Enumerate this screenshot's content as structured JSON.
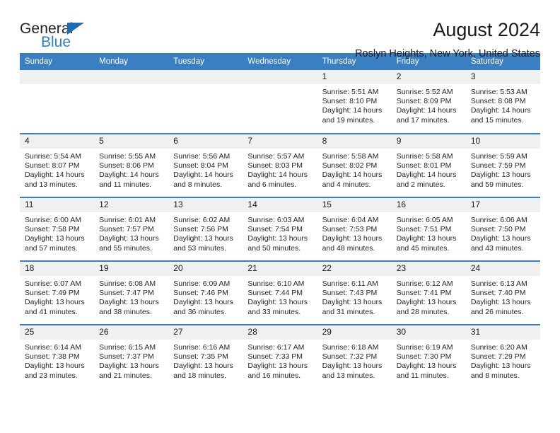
{
  "brand": {
    "name_top": "General",
    "name_bottom": "Blue",
    "triangle_color": "#1b6cb5",
    "blue_text_color": "#2b83c9"
  },
  "header": {
    "title": "August 2024",
    "subtitle": "Roslyn Heights, New York, United States"
  },
  "theme": {
    "header_bg": "#3a7fc1",
    "daynum_bg": "#f0f0f0",
    "row_divider": "#3a7fc1",
    "text": "#1a1a1a"
  },
  "weekday_headers": [
    "Sunday",
    "Monday",
    "Tuesday",
    "Wednesday",
    "Thursday",
    "Friday",
    "Saturday"
  ],
  "labels": {
    "sunrise_prefix": "Sunrise:",
    "sunset_prefix": "Sunset:",
    "daylight_prefix": "Daylight:"
  },
  "weeks": [
    [
      {
        "day": "",
        "empty": true
      },
      {
        "day": "",
        "empty": true
      },
      {
        "day": "",
        "empty": true
      },
      {
        "day": "",
        "empty": true
      },
      {
        "day": "1",
        "sunrise": "Sunrise: 5:51 AM",
        "sunset": "Sunset: 8:10 PM",
        "daylight_line1": "Daylight: 14 hours",
        "daylight_line2": "and 19 minutes."
      },
      {
        "day": "2",
        "sunrise": "Sunrise: 5:52 AM",
        "sunset": "Sunset: 8:09 PM",
        "daylight_line1": "Daylight: 14 hours",
        "daylight_line2": "and 17 minutes."
      },
      {
        "day": "3",
        "sunrise": "Sunrise: 5:53 AM",
        "sunset": "Sunset: 8:08 PM",
        "daylight_line1": "Daylight: 14 hours",
        "daylight_line2": "and 15 minutes."
      }
    ],
    [
      {
        "day": "4",
        "sunrise": "Sunrise: 5:54 AM",
        "sunset": "Sunset: 8:07 PM",
        "daylight_line1": "Daylight: 14 hours",
        "daylight_line2": "and 13 minutes."
      },
      {
        "day": "5",
        "sunrise": "Sunrise: 5:55 AM",
        "sunset": "Sunset: 8:06 PM",
        "daylight_line1": "Daylight: 14 hours",
        "daylight_line2": "and 11 minutes."
      },
      {
        "day": "6",
        "sunrise": "Sunrise: 5:56 AM",
        "sunset": "Sunset: 8:04 PM",
        "daylight_line1": "Daylight: 14 hours",
        "daylight_line2": "and 8 minutes."
      },
      {
        "day": "7",
        "sunrise": "Sunrise: 5:57 AM",
        "sunset": "Sunset: 8:03 PM",
        "daylight_line1": "Daylight: 14 hours",
        "daylight_line2": "and 6 minutes."
      },
      {
        "day": "8",
        "sunrise": "Sunrise: 5:58 AM",
        "sunset": "Sunset: 8:02 PM",
        "daylight_line1": "Daylight: 14 hours",
        "daylight_line2": "and 4 minutes."
      },
      {
        "day": "9",
        "sunrise": "Sunrise: 5:58 AM",
        "sunset": "Sunset: 8:01 PM",
        "daylight_line1": "Daylight: 14 hours",
        "daylight_line2": "and 2 minutes."
      },
      {
        "day": "10",
        "sunrise": "Sunrise: 5:59 AM",
        "sunset": "Sunset: 7:59 PM",
        "daylight_line1": "Daylight: 13 hours",
        "daylight_line2": "and 59 minutes."
      }
    ],
    [
      {
        "day": "11",
        "sunrise": "Sunrise: 6:00 AM",
        "sunset": "Sunset: 7:58 PM",
        "daylight_line1": "Daylight: 13 hours",
        "daylight_line2": "and 57 minutes."
      },
      {
        "day": "12",
        "sunrise": "Sunrise: 6:01 AM",
        "sunset": "Sunset: 7:57 PM",
        "daylight_line1": "Daylight: 13 hours",
        "daylight_line2": "and 55 minutes."
      },
      {
        "day": "13",
        "sunrise": "Sunrise: 6:02 AM",
        "sunset": "Sunset: 7:56 PM",
        "daylight_line1": "Daylight: 13 hours",
        "daylight_line2": "and 53 minutes."
      },
      {
        "day": "14",
        "sunrise": "Sunrise: 6:03 AM",
        "sunset": "Sunset: 7:54 PM",
        "daylight_line1": "Daylight: 13 hours",
        "daylight_line2": "and 50 minutes."
      },
      {
        "day": "15",
        "sunrise": "Sunrise: 6:04 AM",
        "sunset": "Sunset: 7:53 PM",
        "daylight_line1": "Daylight: 13 hours",
        "daylight_line2": "and 48 minutes."
      },
      {
        "day": "16",
        "sunrise": "Sunrise: 6:05 AM",
        "sunset": "Sunset: 7:51 PM",
        "daylight_line1": "Daylight: 13 hours",
        "daylight_line2": "and 45 minutes."
      },
      {
        "day": "17",
        "sunrise": "Sunrise: 6:06 AM",
        "sunset": "Sunset: 7:50 PM",
        "daylight_line1": "Daylight: 13 hours",
        "daylight_line2": "and 43 minutes."
      }
    ],
    [
      {
        "day": "18",
        "sunrise": "Sunrise: 6:07 AM",
        "sunset": "Sunset: 7:49 PM",
        "daylight_line1": "Daylight: 13 hours",
        "daylight_line2": "and 41 minutes."
      },
      {
        "day": "19",
        "sunrise": "Sunrise: 6:08 AM",
        "sunset": "Sunset: 7:47 PM",
        "daylight_line1": "Daylight: 13 hours",
        "daylight_line2": "and 38 minutes."
      },
      {
        "day": "20",
        "sunrise": "Sunrise: 6:09 AM",
        "sunset": "Sunset: 7:46 PM",
        "daylight_line1": "Daylight: 13 hours",
        "daylight_line2": "and 36 minutes."
      },
      {
        "day": "21",
        "sunrise": "Sunrise: 6:10 AM",
        "sunset": "Sunset: 7:44 PM",
        "daylight_line1": "Daylight: 13 hours",
        "daylight_line2": "and 33 minutes."
      },
      {
        "day": "22",
        "sunrise": "Sunrise: 6:11 AM",
        "sunset": "Sunset: 7:43 PM",
        "daylight_line1": "Daylight: 13 hours",
        "daylight_line2": "and 31 minutes."
      },
      {
        "day": "23",
        "sunrise": "Sunrise: 6:12 AM",
        "sunset": "Sunset: 7:41 PM",
        "daylight_line1": "Daylight: 13 hours",
        "daylight_line2": "and 28 minutes."
      },
      {
        "day": "24",
        "sunrise": "Sunrise: 6:13 AM",
        "sunset": "Sunset: 7:40 PM",
        "daylight_line1": "Daylight: 13 hours",
        "daylight_line2": "and 26 minutes."
      }
    ],
    [
      {
        "day": "25",
        "sunrise": "Sunrise: 6:14 AM",
        "sunset": "Sunset: 7:38 PM",
        "daylight_line1": "Daylight: 13 hours",
        "daylight_line2": "and 23 minutes."
      },
      {
        "day": "26",
        "sunrise": "Sunrise: 6:15 AM",
        "sunset": "Sunset: 7:37 PM",
        "daylight_line1": "Daylight: 13 hours",
        "daylight_line2": "and 21 minutes."
      },
      {
        "day": "27",
        "sunrise": "Sunrise: 6:16 AM",
        "sunset": "Sunset: 7:35 PM",
        "daylight_line1": "Daylight: 13 hours",
        "daylight_line2": "and 18 minutes."
      },
      {
        "day": "28",
        "sunrise": "Sunrise: 6:17 AM",
        "sunset": "Sunset: 7:33 PM",
        "daylight_line1": "Daylight: 13 hours",
        "daylight_line2": "and 16 minutes."
      },
      {
        "day": "29",
        "sunrise": "Sunrise: 6:18 AM",
        "sunset": "Sunset: 7:32 PM",
        "daylight_line1": "Daylight: 13 hours",
        "daylight_line2": "and 13 minutes."
      },
      {
        "day": "30",
        "sunrise": "Sunrise: 6:19 AM",
        "sunset": "Sunset: 7:30 PM",
        "daylight_line1": "Daylight: 13 hours",
        "daylight_line2": "and 11 minutes."
      },
      {
        "day": "31",
        "sunrise": "Sunrise: 6:20 AM",
        "sunset": "Sunset: 7:29 PM",
        "daylight_line1": "Daylight: 13 hours",
        "daylight_line2": "and 8 minutes."
      }
    ]
  ]
}
